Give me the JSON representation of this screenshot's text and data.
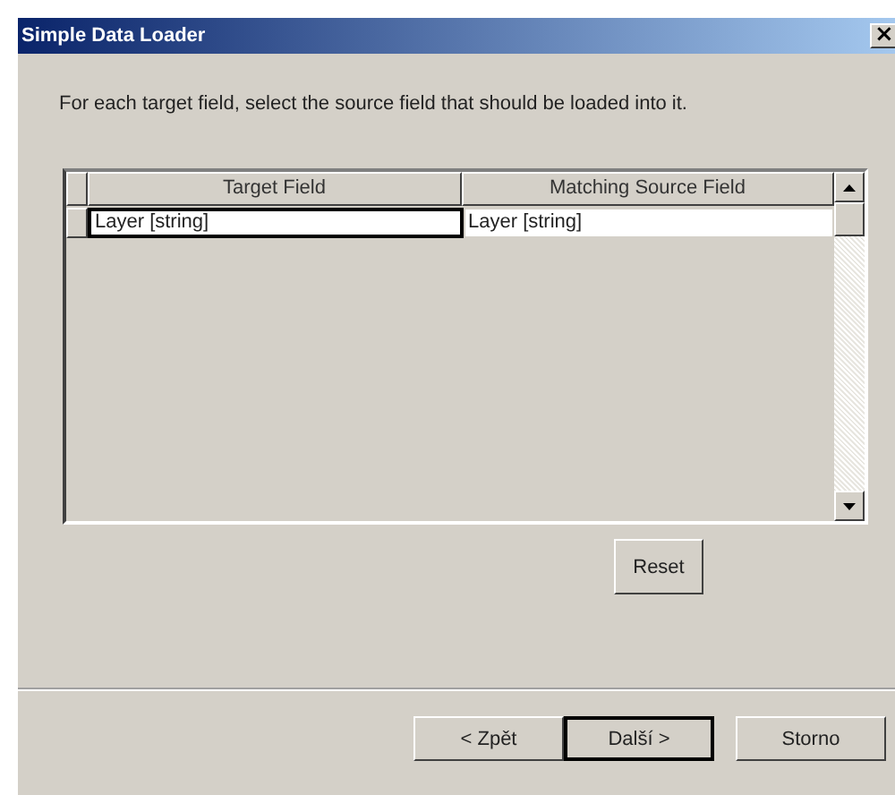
{
  "window": {
    "title": "Simple Data Loader",
    "close": "×"
  },
  "instruction": "For each target field, select the source field that should be loaded into it.",
  "table": {
    "columns": [
      "Target Field",
      "Matching Source Field"
    ],
    "rows": [
      {
        "cells": [
          {
            "text": "Layer [string]",
            "current": true
          },
          {
            "text": "Layer [string]",
            "current": false
          }
        ]
      }
    ]
  },
  "reset_button": "Reset",
  "buttons": [
    {
      "label": "< Zpět",
      "default": false
    },
    {
      "label": "Další >",
      "default": true
    },
    {
      "label": "Storno",
      "default": false
    }
  ]
}
